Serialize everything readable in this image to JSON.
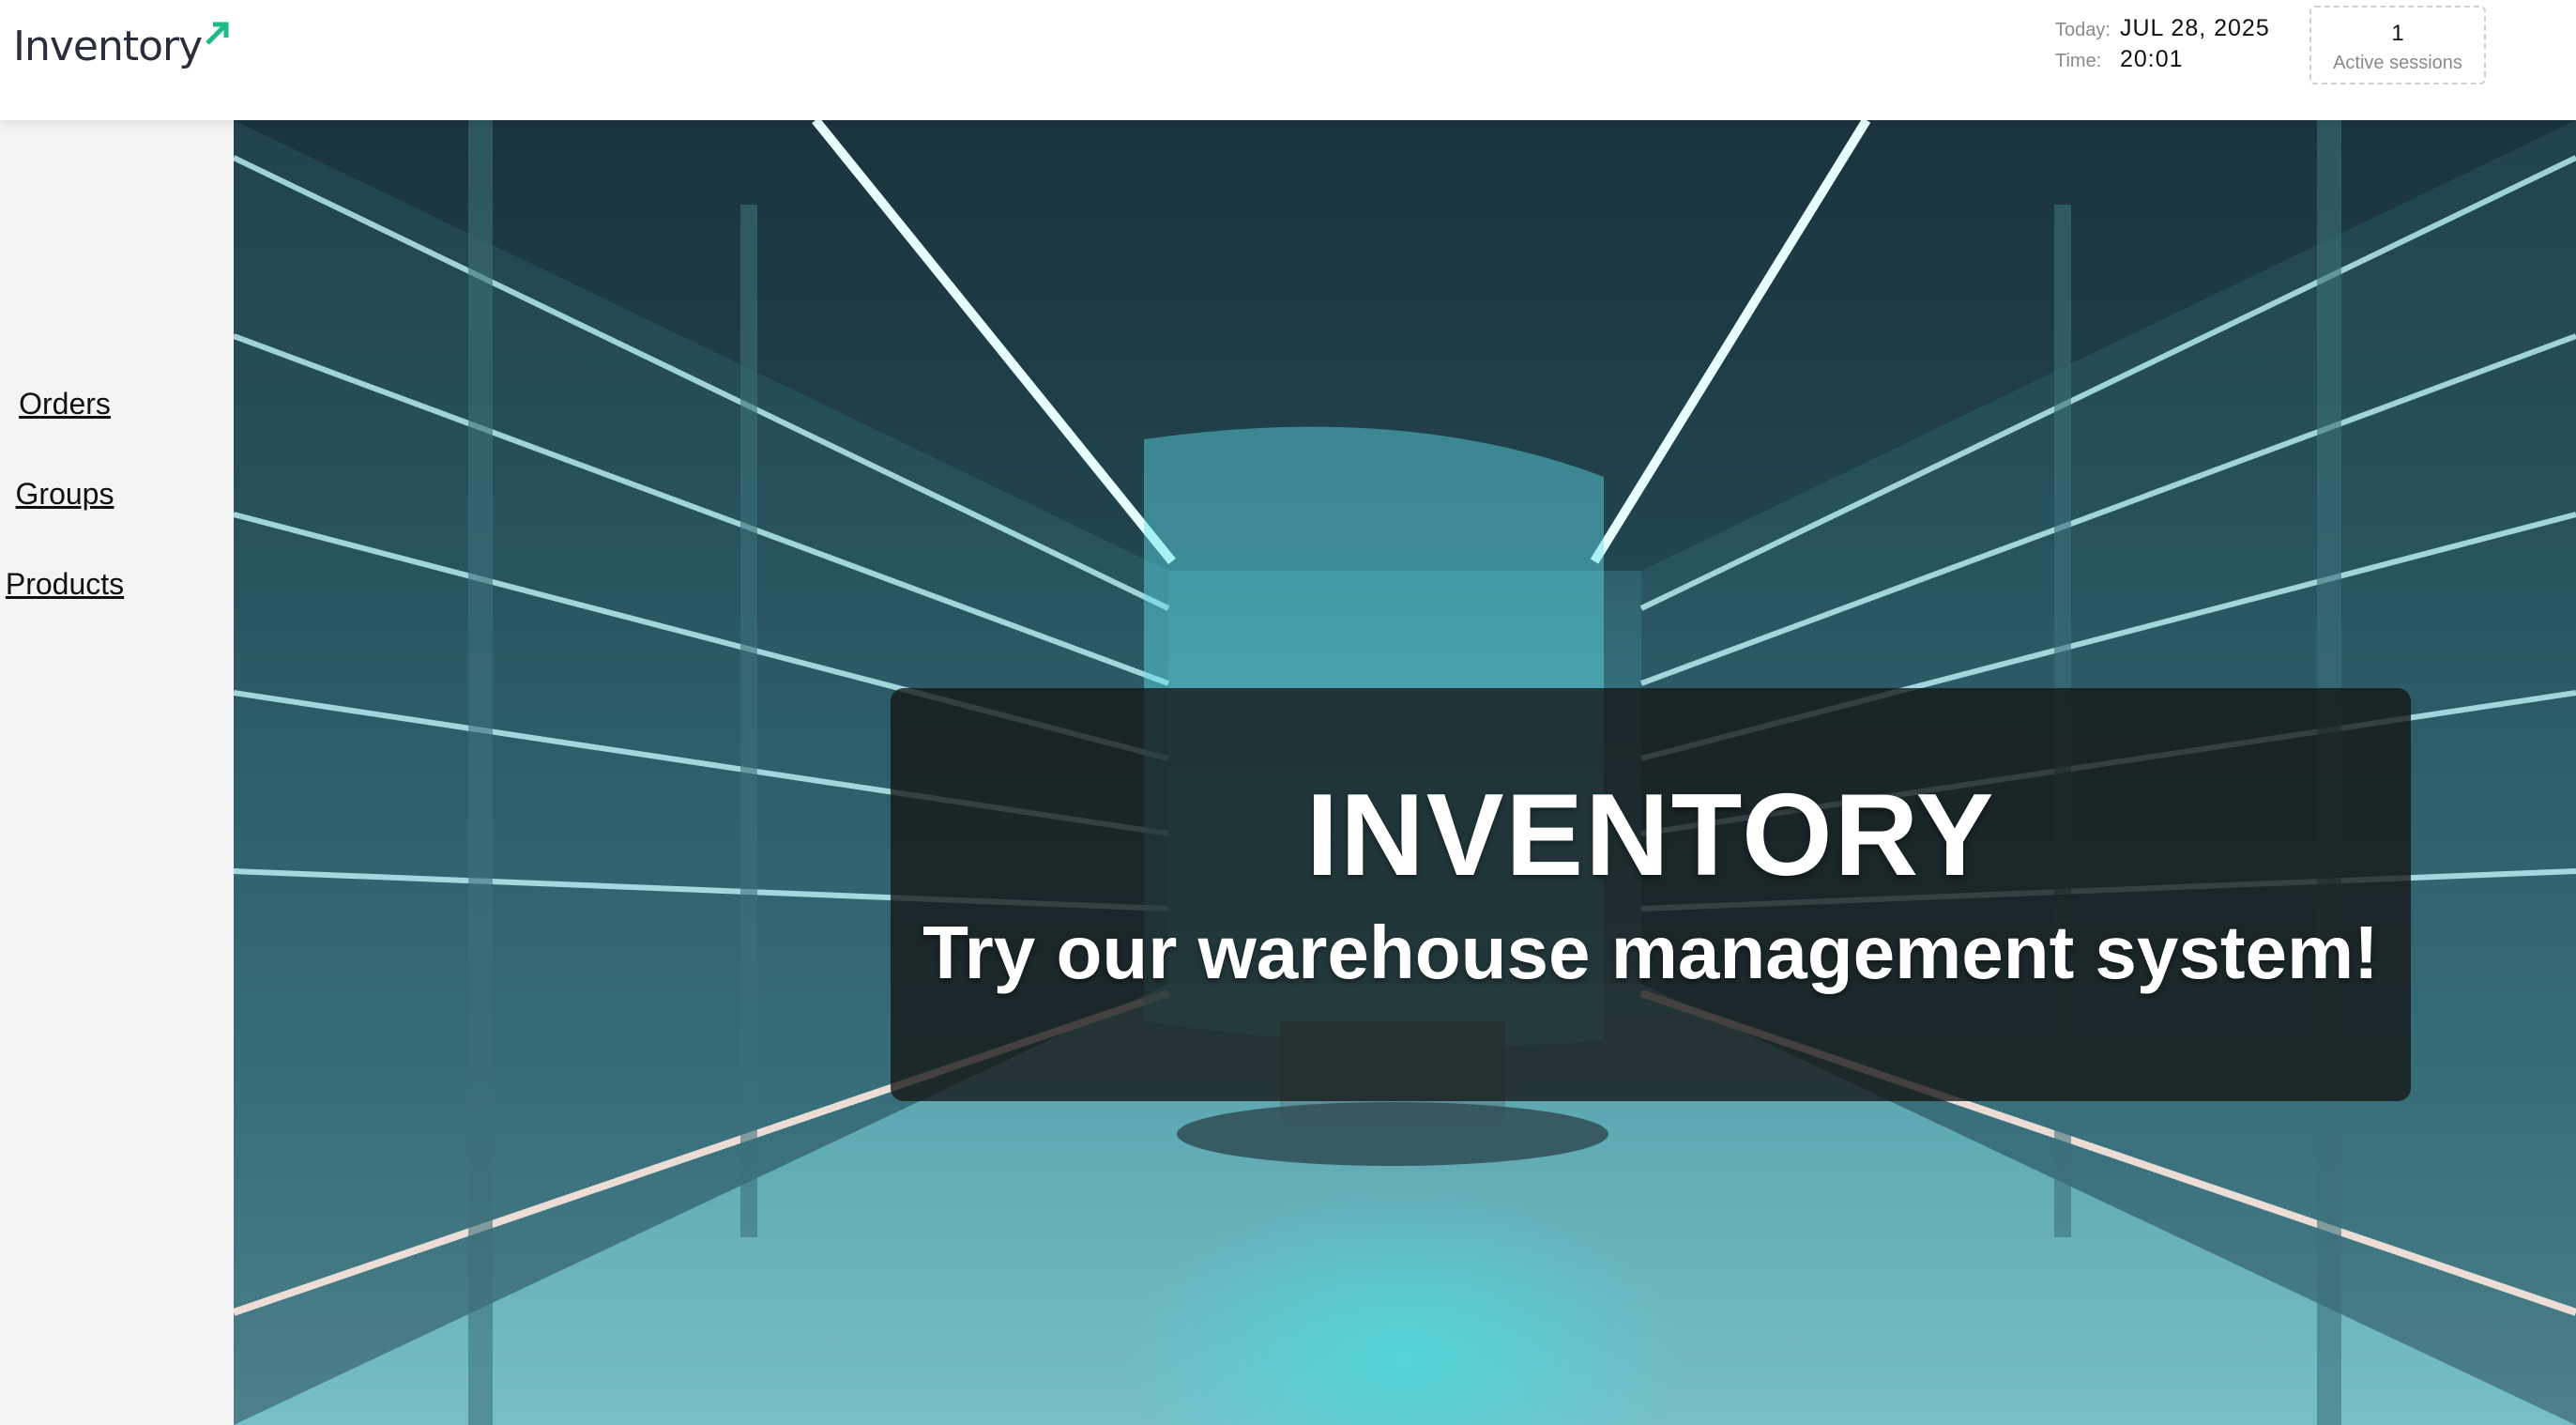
{
  "header": {
    "logo_text": "Inventory",
    "today_label": "Today:",
    "today_value": "JUL 28, 2025",
    "time_label": "Time:",
    "time_value": "20:01",
    "sessions_count": "1",
    "sessions_label": "Active sessions"
  },
  "sidebar": {
    "items": [
      {
        "label": "Orders"
      },
      {
        "label": "Groups"
      },
      {
        "label": "Products"
      }
    ]
  },
  "hero": {
    "title": "INVENTORY",
    "subtitle": "Try our warehouse management system!"
  },
  "colors": {
    "logo_accent": "#1fb985",
    "hero_glow": "#28fffa"
  }
}
